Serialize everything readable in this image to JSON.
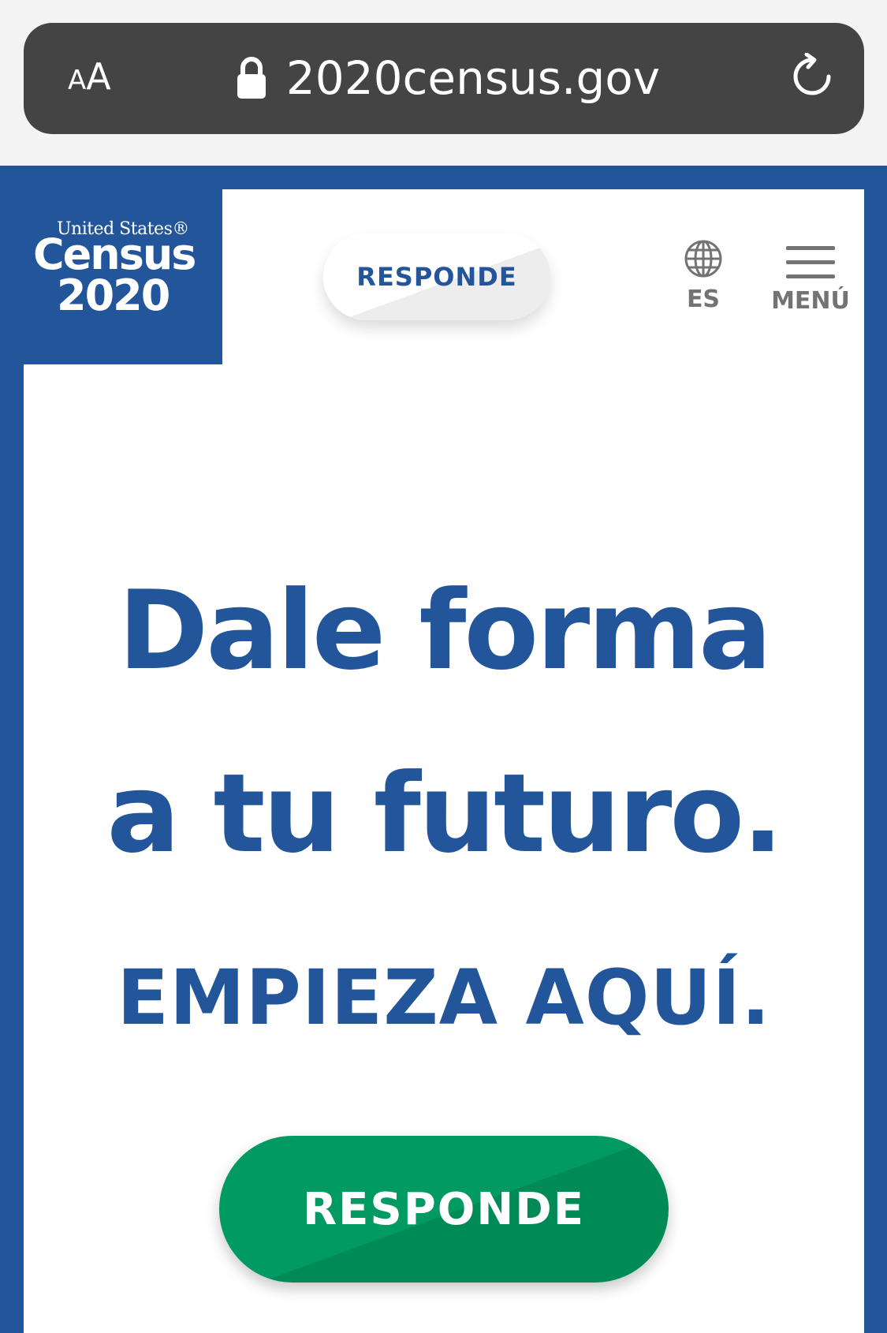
{
  "browser": {
    "reader_small": "A",
    "reader_big": "A",
    "url": "2020census.gov"
  },
  "logo": {
    "line1": "United States®",
    "line2": "Census",
    "line3": "2020"
  },
  "header": {
    "respond_label": "RESPONDE",
    "language_label": "ES",
    "menu_label": "MENÚ"
  },
  "hero": {
    "heading_line1": "Dale forma",
    "heading_line2": "a tu futuro.",
    "subheading": "EMPIEZA AQUÍ.",
    "cta_label": "RESPONDE"
  },
  "icons": {
    "lock": "lock-icon",
    "reload": "reload-icon",
    "globe": "globe-icon",
    "menu": "hamburger-icon"
  },
  "colors": {
    "brand_blue": "#22559a",
    "cta_green": "#019a63",
    "chrome_dark": "#444444",
    "nav_gray": "#737373"
  }
}
